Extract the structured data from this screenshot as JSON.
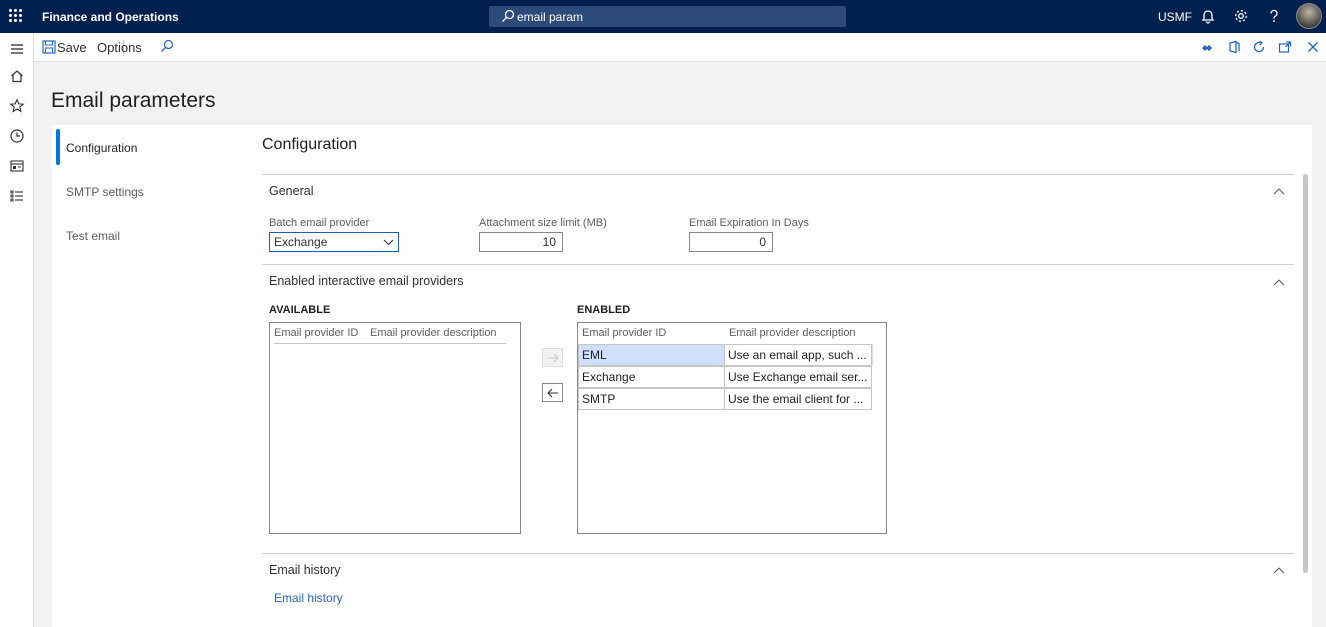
{
  "app": {
    "title": "Finance and Operations",
    "company": "USMF"
  },
  "search": {
    "value": "email param"
  },
  "actions": {
    "save_label": "Save",
    "options_label": "Options"
  },
  "page": {
    "title": "Email parameters"
  },
  "tabs": [
    {
      "label": "Configuration",
      "active": true
    },
    {
      "label": "SMTP settings",
      "active": false
    },
    {
      "label": "Test email",
      "active": false
    }
  ],
  "content": {
    "title": "Configuration",
    "general": {
      "title": "General",
      "batch_provider_label": "Batch email provider",
      "batch_provider_value": "Exchange",
      "attachment_label": "Attachment size limit (MB)",
      "attachment_value": "10",
      "expiration_label": "Email Expiration In Days",
      "expiration_value": "0"
    },
    "interactive": {
      "title": "Enabled interactive email providers",
      "available_title": "AVAILABLE",
      "enabled_title": "ENABLED",
      "col_id": "Email provider ID",
      "col_desc": "Email provider description",
      "enabled_rows": [
        {
          "id": "EML",
          "desc": "Use an email app, such ..."
        },
        {
          "id": "Exchange",
          "desc": "Use Exchange email ser..."
        },
        {
          "id": "SMTP",
          "desc": "Use the email client for ..."
        }
      ]
    },
    "history": {
      "title": "Email history",
      "link": "Email history"
    }
  },
  "colors": {
    "topbar": "#002050",
    "accent": "#0078d4",
    "selected_row": "#cfe0fc",
    "link": "#2266c5"
  }
}
